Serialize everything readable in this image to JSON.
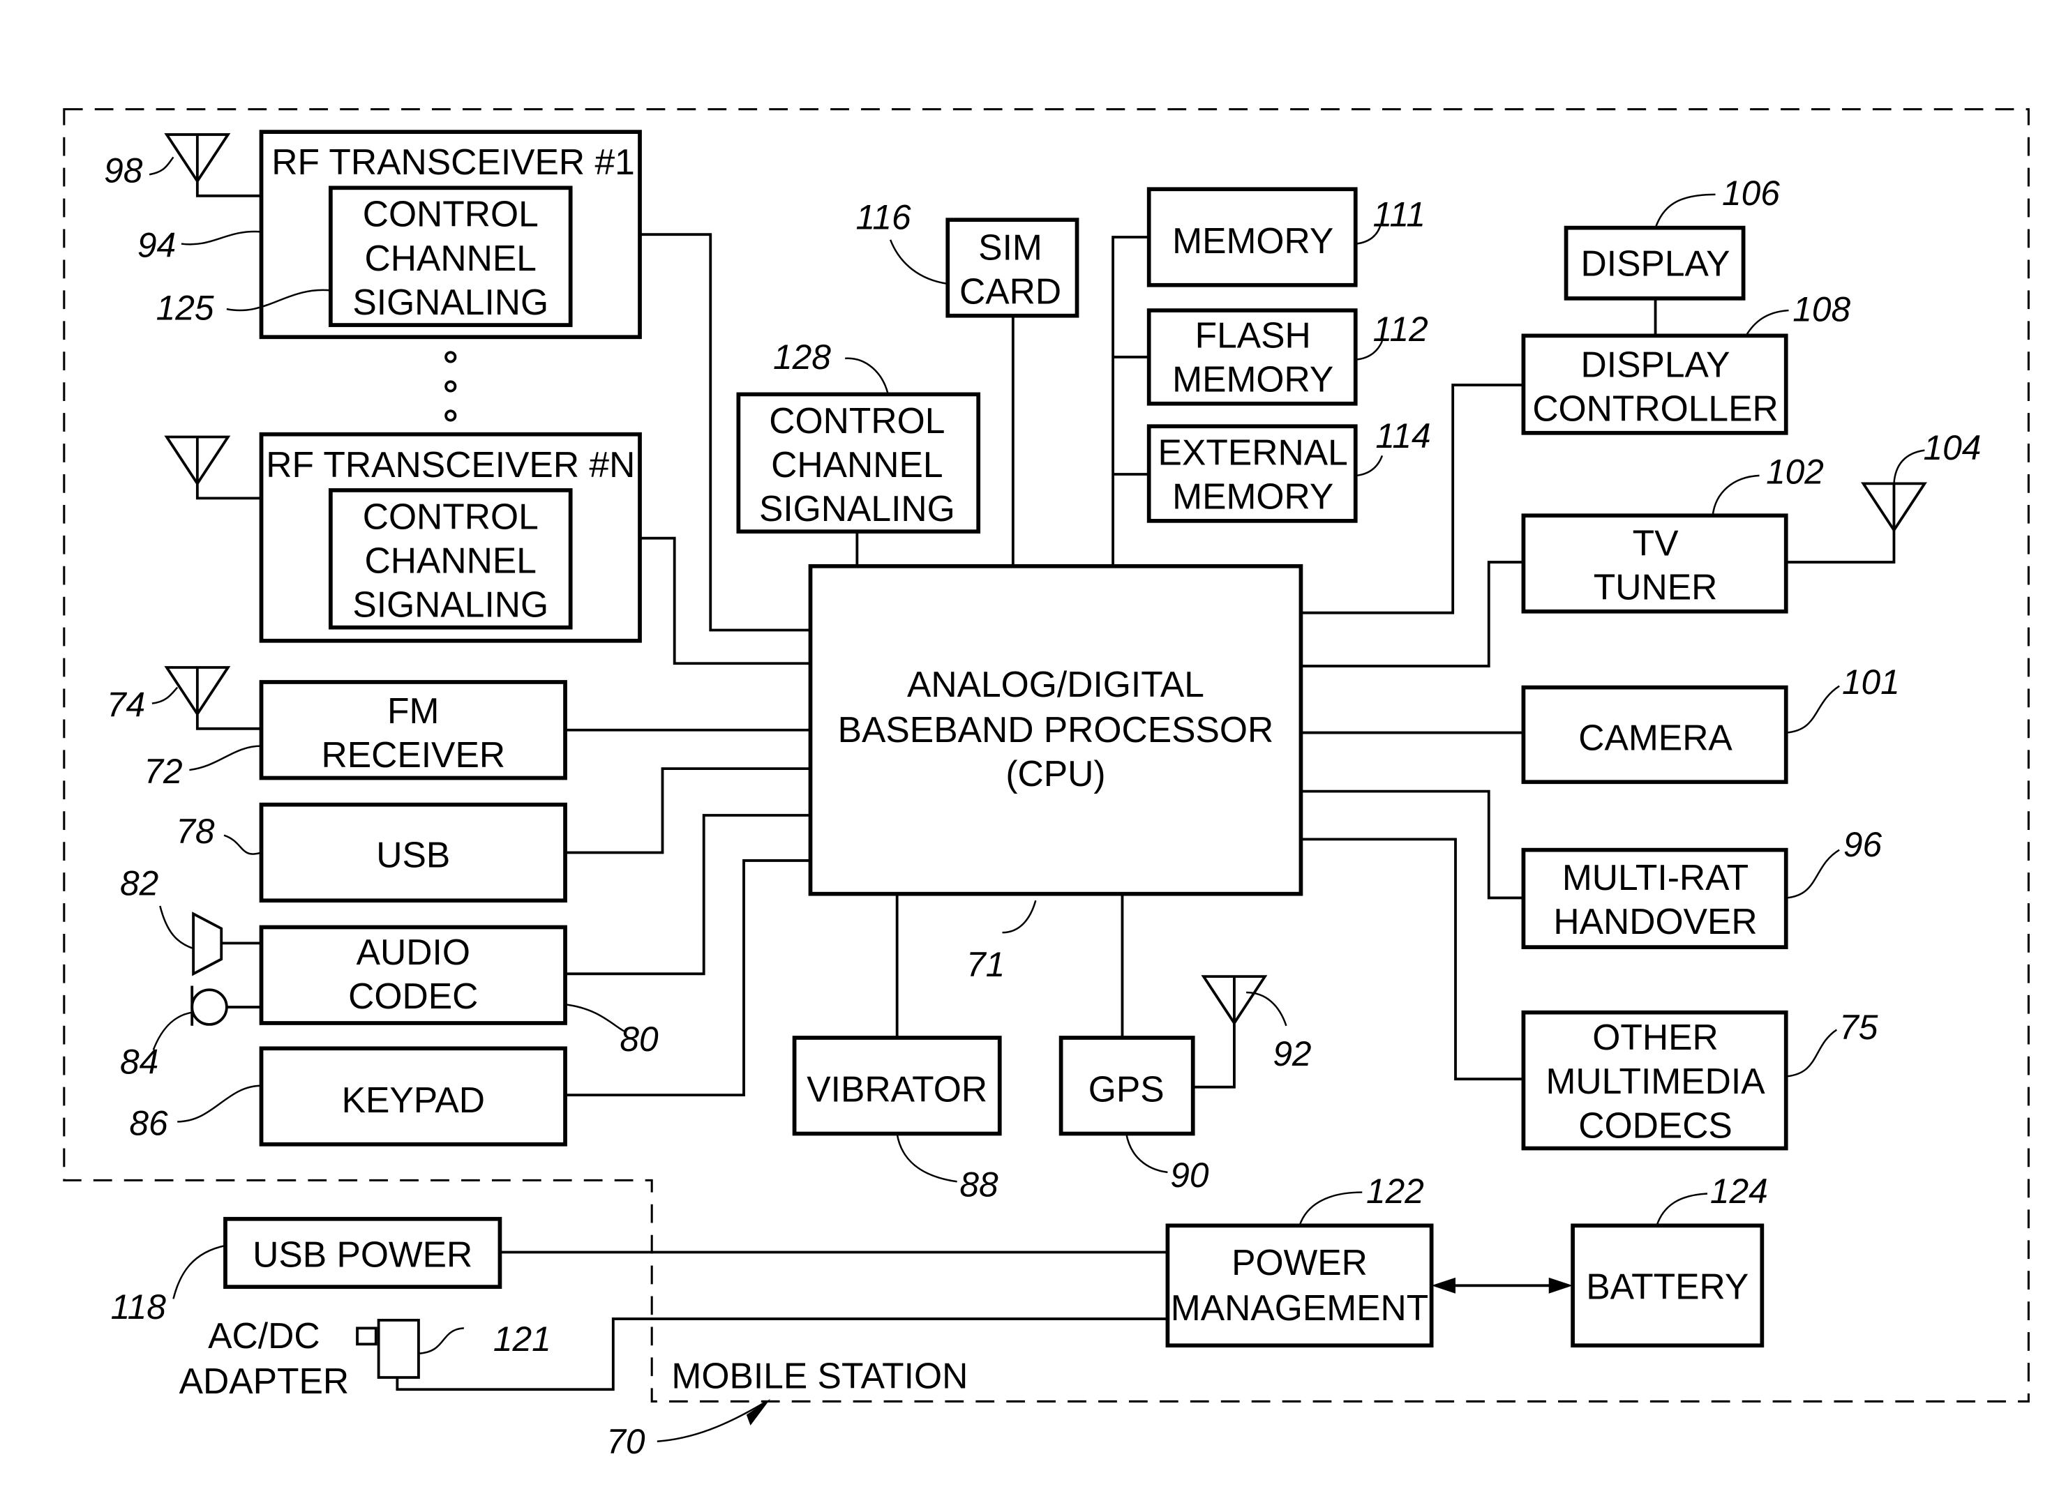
{
  "figure": {
    "boundary_label": "MOBILE STATION",
    "boundary_ref": "70"
  },
  "blocks": {
    "rf1": {
      "title": "RF TRANSCEIVER #1",
      "ref": "94",
      "inner": [
        "CONTROL",
        "CHANNEL",
        "SIGNALING"
      ],
      "inner_ref": "125",
      "antenna_ref": "98"
    },
    "rfn": {
      "title": "RF TRANSCEIVER #N",
      "inner": [
        "CONTROL",
        "CHANNEL",
        "SIGNALING"
      ]
    },
    "fm": {
      "lines": [
        "FM",
        "RECEIVER"
      ],
      "ref": "72",
      "antenna_ref": "74"
    },
    "usb": {
      "lines": [
        "USB"
      ],
      "ref": "78"
    },
    "audio": {
      "lines": [
        "AUDIO",
        "CODEC"
      ],
      "ref": "80",
      "speaker_ref": "82",
      "mic_ref": "84"
    },
    "keypad": {
      "lines": [
        "KEYPAD"
      ],
      "ref": "86"
    },
    "ccs": {
      "lines": [
        "CONTROL",
        "CHANNEL",
        "SIGNALING"
      ],
      "ref": "128"
    },
    "sim": {
      "lines": [
        "SIM",
        "CARD"
      ],
      "ref": "116"
    },
    "memory": {
      "lines": [
        "MEMORY"
      ],
      "ref": "111"
    },
    "flash": {
      "lines": [
        "FLASH",
        "MEMORY"
      ],
      "ref": "112"
    },
    "extmem": {
      "lines": [
        "EXTERNAL",
        "MEMORY"
      ],
      "ref": "114"
    },
    "display": {
      "lines": [
        "DISPLAY"
      ],
      "ref": "106"
    },
    "dispctl": {
      "lines": [
        "DISPLAY",
        "CONTROLLER"
      ],
      "ref": "108"
    },
    "tv": {
      "lines": [
        "TV",
        "TUNER"
      ],
      "ref": "102",
      "antenna_ref": "104"
    },
    "cpu": {
      "lines": [
        "ANALOG/DIGITAL",
        "BASEBAND PROCESSOR",
        "(CPU)"
      ],
      "ref": "71"
    },
    "camera": {
      "lines": [
        "CAMERA"
      ],
      "ref": "101"
    },
    "multirat": {
      "lines": [
        "MULTI-RAT",
        "HANDOVER"
      ],
      "ref": "96"
    },
    "othercodec": {
      "lines": [
        "OTHER",
        "MULTIMEDIA",
        "CODECS"
      ],
      "ref": "75"
    },
    "vibrator": {
      "lines": [
        "VIBRATOR"
      ],
      "ref": "88"
    },
    "gps": {
      "lines": [
        "GPS"
      ],
      "ref": "90",
      "antenna_ref": "92"
    },
    "usbpower": {
      "lines": [
        "USB POWER"
      ],
      "ref": "118"
    },
    "acdc": {
      "lines": [
        "AC/DC",
        "ADAPTER"
      ],
      "ref": "121"
    },
    "power": {
      "lines": [
        "POWER",
        "MANAGEMENT"
      ],
      "ref": "122"
    },
    "battery": {
      "lines": [
        "BATTERY"
      ],
      "ref": "124"
    }
  }
}
